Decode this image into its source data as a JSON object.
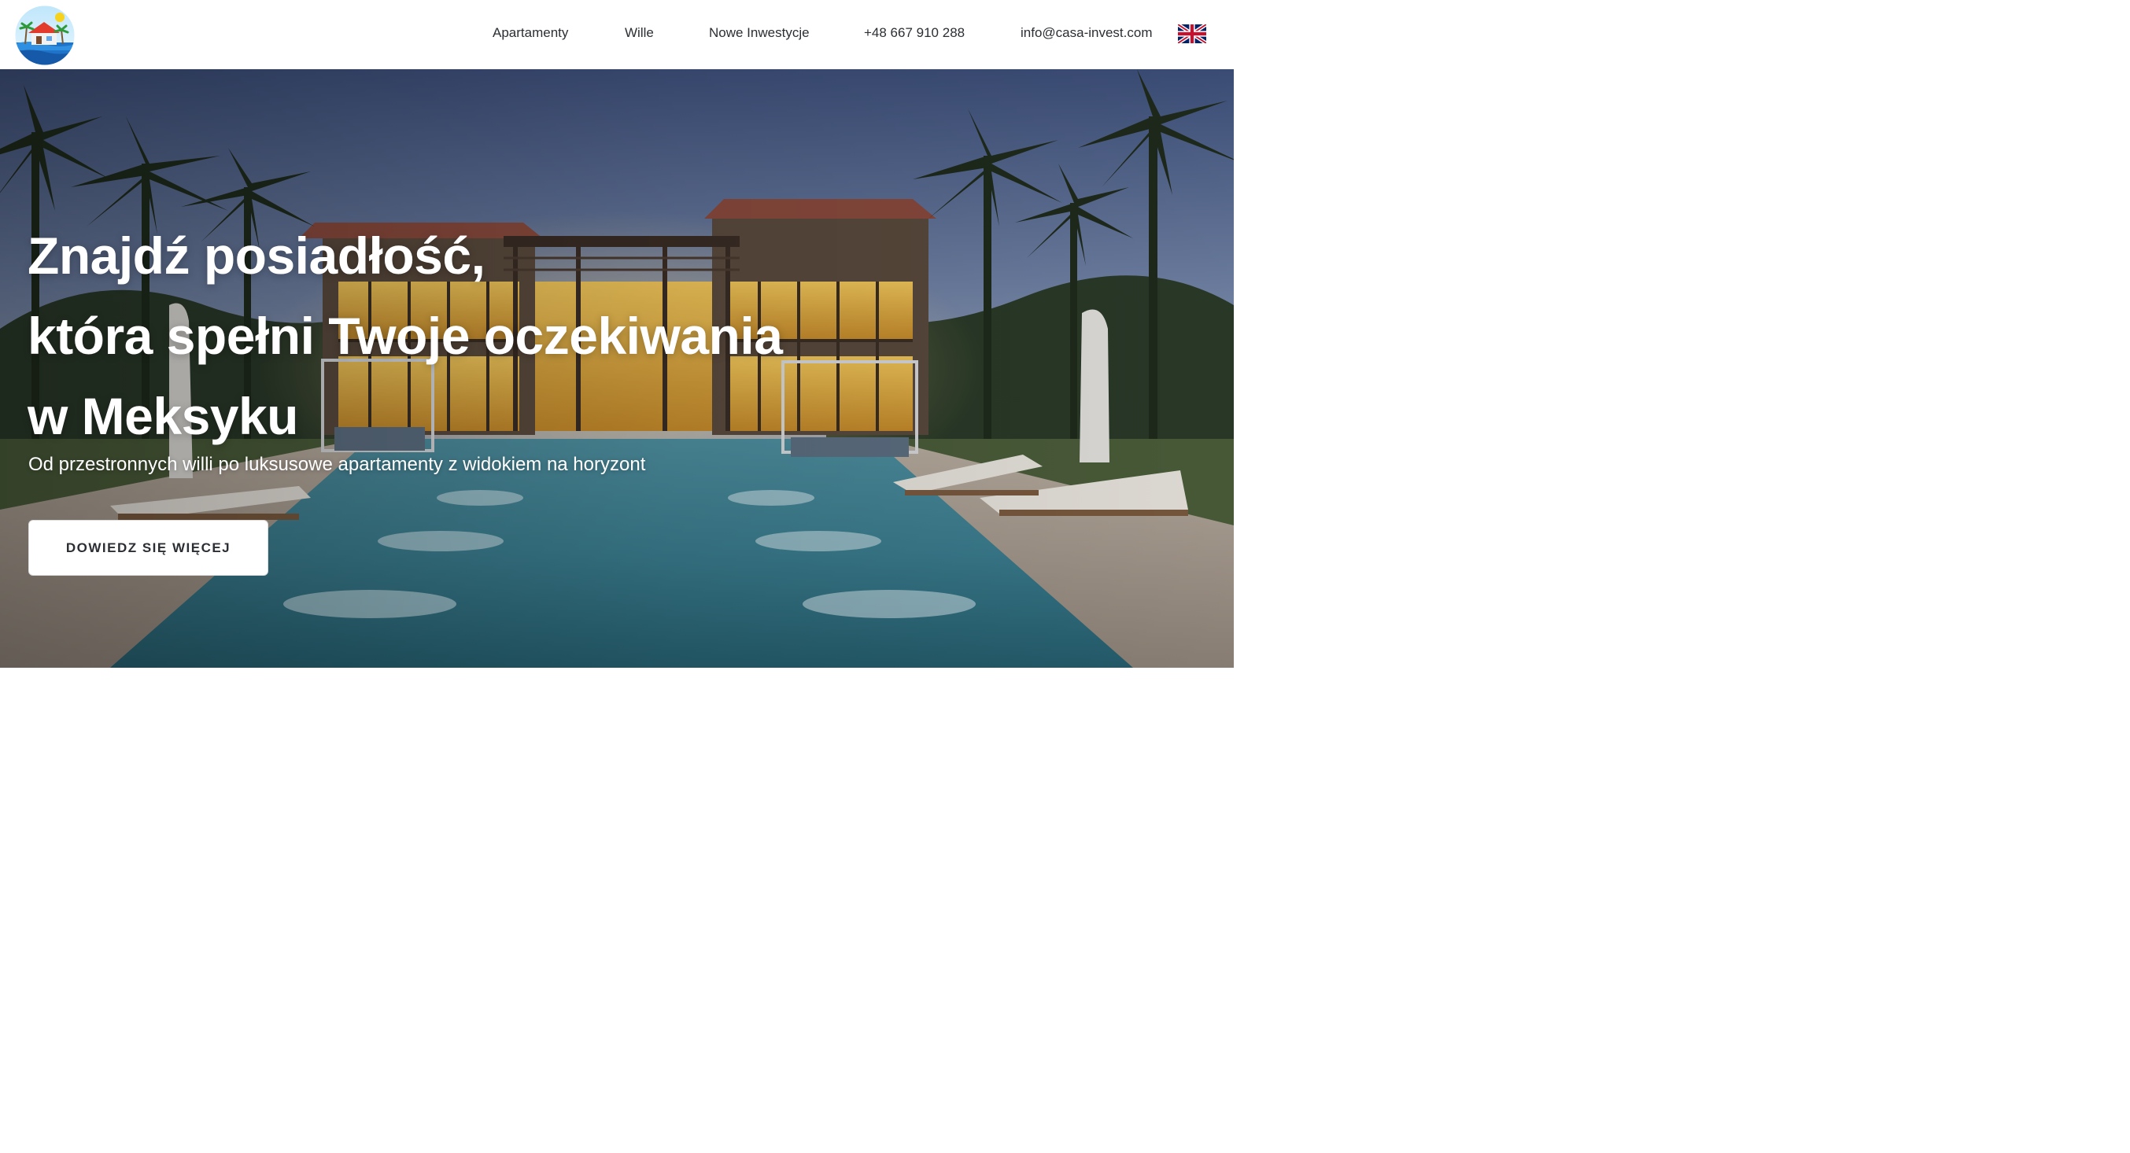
{
  "header": {
    "nav": {
      "apartments": "Apartamenty",
      "villas": "Wille",
      "new_investments": "Nowe Inwestycje",
      "phone": "+48 667 910 288",
      "email": "info@casa-invest.com"
    },
    "language_flag_icon": "uk-flag-icon",
    "logo_icon": "house-island-logo"
  },
  "hero": {
    "headline": {
      "line1": "Znajdź posiadłość,",
      "line2": "która spełni Twoje oczekiwania",
      "line3": "w Meksyku"
    },
    "subheadline": "Od przestronnych willi po luksusowe apartamenty z widokiem na horyzont",
    "cta_label": "DOWIEDZ SIĘ WIĘCEJ"
  },
  "colors": {
    "nav_text": "#2b2f33",
    "hero_text": "#ffffff",
    "button_bg": "#ffffff",
    "button_text": "#2b2f33"
  }
}
